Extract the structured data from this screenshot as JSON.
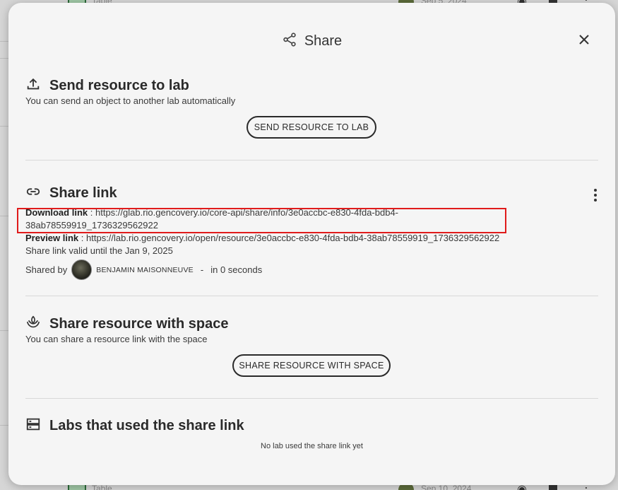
{
  "background": {
    "rows": [
      {
        "label": "Table",
        "date": "Sep 5, 2024"
      },
      {
        "label": "Table",
        "date": "Sep 10, 2024"
      }
    ]
  },
  "dialog": {
    "title": "Share",
    "close_icon": "close-icon",
    "share_icon": "share-icon"
  },
  "send_to_lab": {
    "icon": "upload-icon",
    "title": "Send resource to lab",
    "subtitle": "You can send an object to another lab automatically",
    "button_label": "SEND RESOURCE TO LAB"
  },
  "share_link": {
    "icon": "link-icon",
    "title": "Share link",
    "download_label": "Download link",
    "download_url": "https://glab.rio.gencovery.io/core-api/share/info/3e0accbc-e830-4fda-bdb4-38ab78559919_1736329562922",
    "download_url_line1": "https://glab.rio.gencovery.io/core-api/share/info/3e0accbc-e830-4fda-bdb4-",
    "download_url_line2": "38ab78559919_1736329562922",
    "preview_label": "Preview link",
    "preview_url": "https://lab.rio.gencovery.io/open/resource/3e0accbc-e830-4fda-bdb4-38ab78559919_1736329562922",
    "validity": "Share link valid until the Jan 9, 2025",
    "shared_by_label": "Shared by",
    "user_name": "BENJAMIN MAISONNEUVE",
    "separator": "-",
    "time_ago": "in 0 seconds"
  },
  "share_with_space": {
    "icon": "space-icon",
    "title": "Share resource with space",
    "subtitle": "You can share a resource link with the space",
    "button_label": "SHARE RESOURCE WITH SPACE"
  },
  "labs_used": {
    "icon": "storage-icon",
    "title": "Labs that used the share link",
    "empty_message": "No lab used the share link yet"
  },
  "colors": {
    "highlight": "#e01b1b",
    "dialog_bg": "#f5f5f5",
    "text": "#2a2a2a"
  }
}
